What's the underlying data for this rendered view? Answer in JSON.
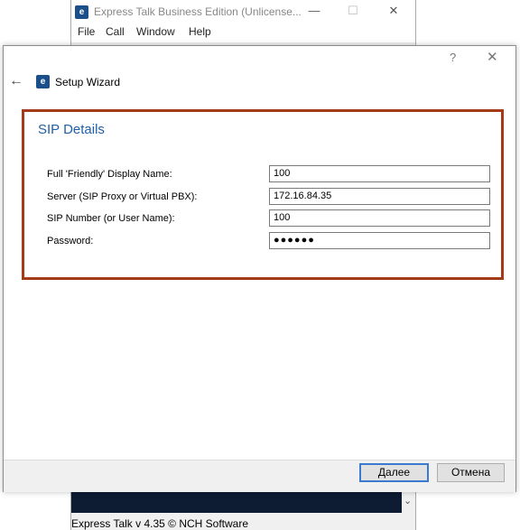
{
  "main_window": {
    "title": "Express Talk Business Edition (Unlicense...",
    "app_icon_glyph": "e",
    "controls": {
      "minimize": "—",
      "maximize": "☐",
      "close": "✕"
    },
    "menu": [
      "File",
      "Call",
      "Window",
      "Help"
    ],
    "scroll_arrow": "⌄",
    "status_text": "Express Talk v 4.35 © NCH Software"
  },
  "dialog": {
    "help_glyph": "?",
    "close_glyph": "✕",
    "back_glyph": "←",
    "app_icon_glyph": "e",
    "title": "Setup Wizard",
    "section_title": "SIP Details",
    "fields": [
      {
        "label": "Full 'Friendly' Display Name:",
        "value": "100"
      },
      {
        "label": "Server (SIP Proxy or Virtual PBX):",
        "value": "172.16.84.35"
      },
      {
        "label": "SIP Number (or User Name):",
        "value": "100"
      },
      {
        "label": "Password:",
        "value": "●●●●●●"
      }
    ],
    "buttons": {
      "next": "Далее",
      "cancel": "Отмена"
    }
  },
  "colors": {
    "section_border": "#a33a18",
    "section_title": "#1f5fa8",
    "primary_button_border": "#3c7ad1",
    "dark_strip": "#0d1b33"
  },
  "icons": [
    "app-icon",
    "back-arrow-icon",
    "help-icon",
    "close-icon",
    "minimize-icon",
    "maximize-icon",
    "chevron-down-icon"
  ]
}
